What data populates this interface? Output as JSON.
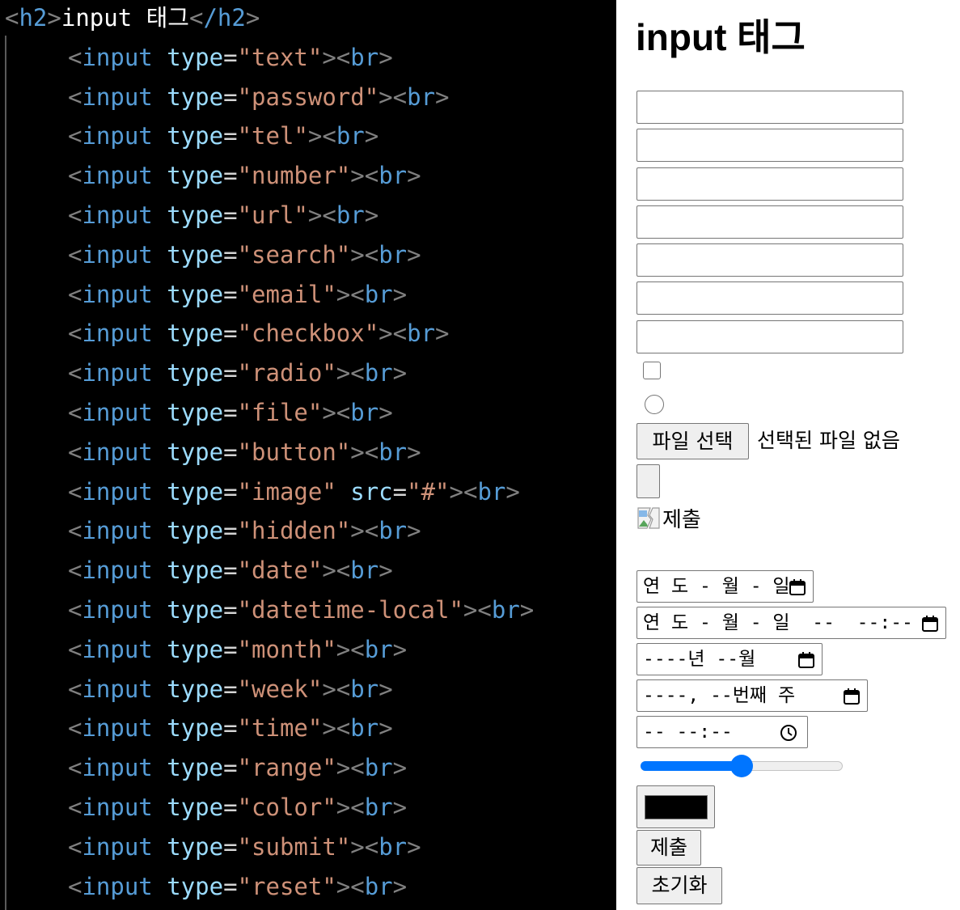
{
  "editor": {
    "heading": {
      "open": "h2",
      "text": "input 태그",
      "close": "/h2"
    },
    "lines": [
      {
        "type": "text"
      },
      {
        "type": "password"
      },
      {
        "type": "tel"
      },
      {
        "type": "number"
      },
      {
        "type": "url"
      },
      {
        "type": "search"
      },
      {
        "type": "email"
      },
      {
        "type": "checkbox"
      },
      {
        "type": "radio"
      },
      {
        "type": "file"
      },
      {
        "type": "button"
      },
      {
        "type": "image",
        "extra_attr": "src",
        "extra_value": "#"
      },
      {
        "type": "hidden"
      },
      {
        "type": "date"
      },
      {
        "type": "datetime-local"
      },
      {
        "type": "month"
      },
      {
        "type": "week"
      },
      {
        "type": "time"
      },
      {
        "type": "range"
      },
      {
        "type": "color"
      },
      {
        "type": "submit"
      },
      {
        "type": "reset"
      }
    ],
    "tokens": {
      "tag": "input",
      "attr": "type",
      "br": "br"
    },
    "colors": {
      "background": "#000000",
      "punct": "#808080",
      "tag": "#569cd6",
      "attr": "#9cdcfe",
      "string": "#ce9178",
      "text": "#ffffff"
    }
  },
  "preview": {
    "title": "input 태그",
    "text_inputs": [
      {
        "type": "text",
        "value": ""
      },
      {
        "type": "password",
        "value": ""
      },
      {
        "type": "tel",
        "value": ""
      },
      {
        "type": "number",
        "value": ""
      },
      {
        "type": "url",
        "value": ""
      },
      {
        "type": "search",
        "value": ""
      },
      {
        "type": "email",
        "value": ""
      }
    ],
    "checkbox": {
      "checked": false
    },
    "radio": {
      "checked": false
    },
    "file": {
      "button_label": "파일 선택",
      "status": "선택된 파일 없음"
    },
    "button": {
      "label": ""
    },
    "image": {
      "alt": "제출",
      "icon": "broken-image-icon"
    },
    "date": {
      "placeholder": "연 도 - 월 - 일",
      "icon": "calendar-icon"
    },
    "datetime_local": {
      "placeholder": "연 도 - 월 - 일  --  --:--",
      "icon": "calendar-icon"
    },
    "month": {
      "placeholder": "----년 --월",
      "icon": "calendar-icon"
    },
    "week": {
      "placeholder": "----, --번째 주",
      "icon": "calendar-icon"
    },
    "time": {
      "placeholder": "-- --:--",
      "icon": "clock-icon"
    },
    "range": {
      "value": 0.5
    },
    "color": {
      "value": "#000000"
    },
    "submit": {
      "label": "제출"
    },
    "reset": {
      "label": "초기화"
    },
    "accent_color": "#0075ff"
  }
}
